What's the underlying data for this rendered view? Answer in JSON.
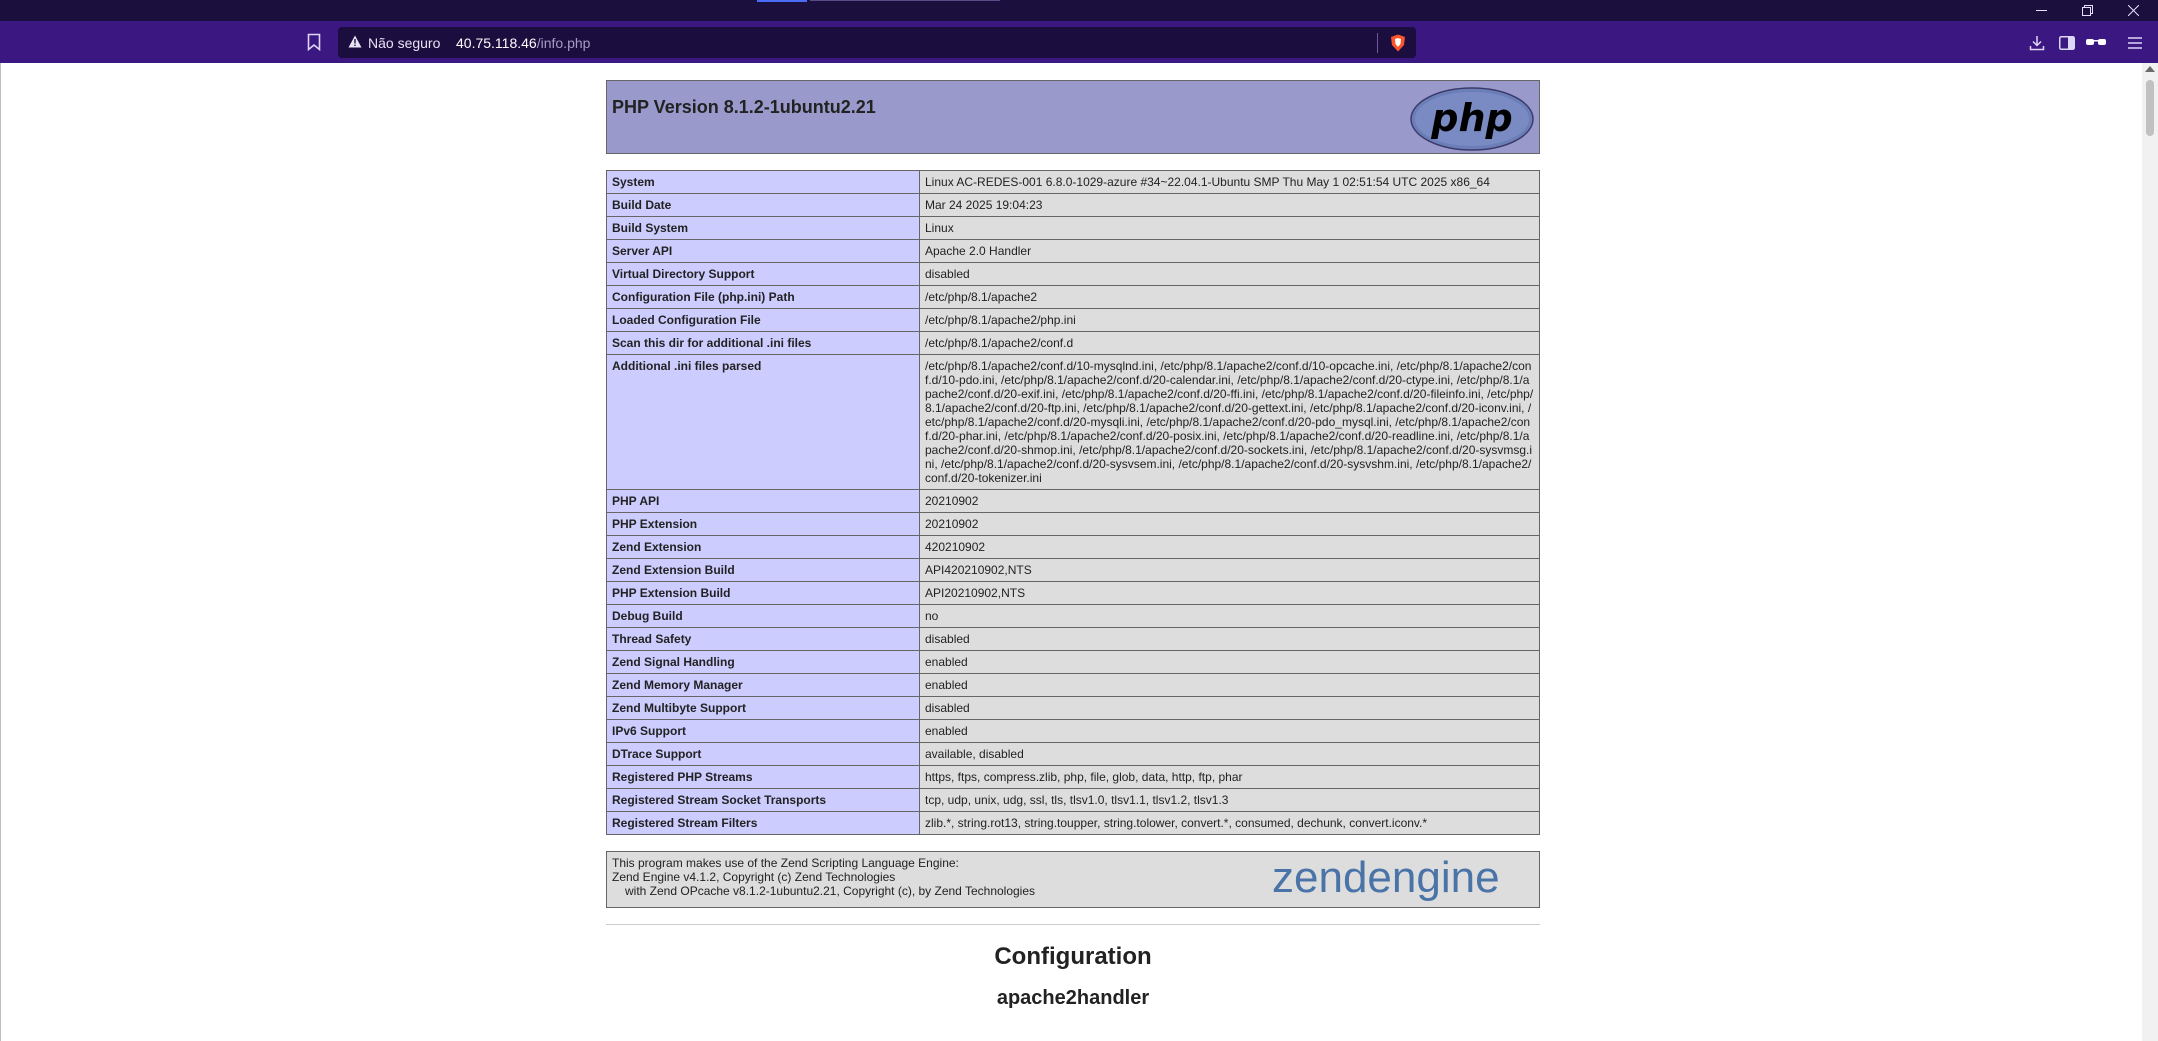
{
  "browser": {
    "security_label": "Não seguro",
    "url_host": "40.75.118.46",
    "url_path": "/info.php",
    "icons": [
      "bookmark-icon",
      "warning-icon",
      "brave-shield-icon",
      "download-icon",
      "sidebar-icon",
      "private-glasses-icon",
      "menu-icon"
    ],
    "window_controls": [
      "minimize-icon",
      "restore-icon",
      "close-icon"
    ],
    "colors": {
      "titlebar": "#1a0f3d",
      "toolbar": "#3b1782",
      "urlbar": "#1c0d3f"
    }
  },
  "page": {
    "title": "PHP Version 8.1.2-1ubuntu2.21",
    "php_logo_text": "php",
    "rows": [
      {
        "label": "System",
        "value": "Linux AC-REDES-001 6.8.0-1029-azure #34~22.04.1-Ubuntu SMP Thu May 1 02:51:54 UTC 2025 x86_64"
      },
      {
        "label": "Build Date",
        "value": "Mar 24 2025 19:04:23"
      },
      {
        "label": "Build System",
        "value": "Linux"
      },
      {
        "label": "Server API",
        "value": "Apache 2.0 Handler"
      },
      {
        "label": "Virtual Directory Support",
        "value": "disabled"
      },
      {
        "label": "Configuration File (php.ini) Path",
        "value": "/etc/php/8.1/apache2"
      },
      {
        "label": "Loaded Configuration File",
        "value": "/etc/php/8.1/apache2/php.ini"
      },
      {
        "label": "Scan this dir for additional .ini files",
        "value": "/etc/php/8.1/apache2/conf.d"
      },
      {
        "label": "Additional .ini files parsed",
        "value": "/etc/php/8.1/apache2/conf.d/10-mysqlnd.ini, /etc/php/8.1/apache2/conf.d/10-opcache.ini, /etc/php/8.1/apache2/conf.d/10-pdo.ini, /etc/php/8.1/apache2/conf.d/20-calendar.ini, /etc/php/8.1/apache2/conf.d/20-ctype.ini, /etc/php/8.1/apache2/conf.d/20-exif.ini, /etc/php/8.1/apache2/conf.d/20-ffi.ini, /etc/php/8.1/apache2/conf.d/20-fileinfo.ini, /etc/php/8.1/apache2/conf.d/20-ftp.ini, /etc/php/8.1/apache2/conf.d/20-gettext.ini, /etc/php/8.1/apache2/conf.d/20-iconv.ini, /etc/php/8.1/apache2/conf.d/20-mysqli.ini, /etc/php/8.1/apache2/conf.d/20-pdo_mysql.ini, /etc/php/8.1/apache2/conf.d/20-phar.ini, /etc/php/8.1/apache2/conf.d/20-posix.ini, /etc/php/8.1/apache2/conf.d/20-readline.ini, /etc/php/8.1/apache2/conf.d/20-shmop.ini, /etc/php/8.1/apache2/conf.d/20-sockets.ini, /etc/php/8.1/apache2/conf.d/20-sysvmsg.ini, /etc/php/8.1/apache2/conf.d/20-sysvsem.ini, /etc/php/8.1/apache2/conf.d/20-sysvshm.ini, /etc/php/8.1/apache2/conf.d/20-tokenizer.ini"
      },
      {
        "label": "PHP API",
        "value": "20210902"
      },
      {
        "label": "PHP Extension",
        "value": "20210902"
      },
      {
        "label": "Zend Extension",
        "value": "420210902"
      },
      {
        "label": "Zend Extension Build",
        "value": "API420210902,NTS"
      },
      {
        "label": "PHP Extension Build",
        "value": "API20210902,NTS"
      },
      {
        "label": "Debug Build",
        "value": "no"
      },
      {
        "label": "Thread Safety",
        "value": "disabled"
      },
      {
        "label": "Zend Signal Handling",
        "value": "enabled"
      },
      {
        "label": "Zend Memory Manager",
        "value": "enabled"
      },
      {
        "label": "Zend Multibyte Support",
        "value": "disabled"
      },
      {
        "label": "IPv6 Support",
        "value": "enabled"
      },
      {
        "label": "DTrace Support",
        "value": "available, disabled"
      },
      {
        "label": "Registered PHP Streams",
        "value": "https, ftps, compress.zlib, php, file, glob, data, http, ftp, phar"
      },
      {
        "label": "Registered Stream Socket Transports",
        "value": "tcp, udp, unix, udg, ssl, tls, tlsv1.0, tlsv1.1, tlsv1.2, tlsv1.3"
      },
      {
        "label": "Registered Stream Filters",
        "value": "zlib.*, string.rot13, string.toupper, string.tolower, convert.*, consumed, dechunk, convert.iconv.*"
      }
    ],
    "zend": {
      "line1": "This program makes use of the Zend Scripting Language Engine:",
      "line2": "Zend Engine v4.1.2, Copyright (c) Zend Technologies",
      "line3": "with Zend OPcache v8.1.2-1ubuntu2.21, Copyright (c), by Zend Technologies",
      "logo_word1": "zend",
      "logo_word2": "engine"
    },
    "section_title": "Configuration",
    "module_title": "apache2handler",
    "colors": {
      "header_bg": "#9999cc",
      "label_bg": "#ccccff",
      "value_bg": "#dddddd",
      "border": "#666666"
    }
  }
}
